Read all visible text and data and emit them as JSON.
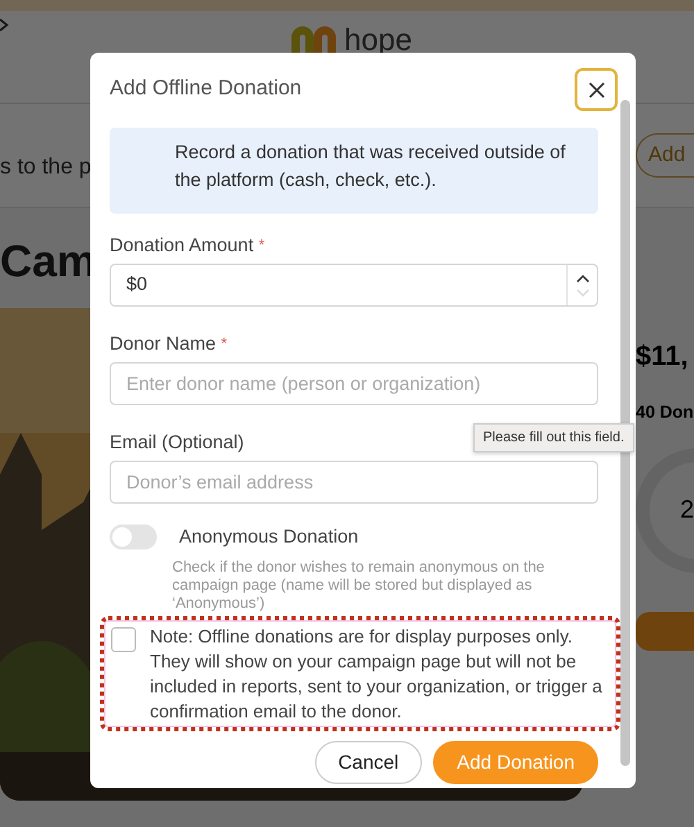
{
  "page": {
    "logo_text": "hope",
    "subtitle_fragment": "s to the p",
    "add_button": "Add",
    "heading_fragment": "Cam",
    "amount_fragment": "$11,",
    "donors_fragment": "40 Don",
    "percent_fragment": "2"
  },
  "modal": {
    "title": "Add Offline Donation",
    "info": "Record a donation that was received outside of the platform (cash, check, etc.).",
    "fields": [
      {
        "label": "Donation Amount",
        "required_mark": "*",
        "kind": "number",
        "value": "$0"
      },
      {
        "label": "Donor Name",
        "required_mark": "*",
        "kind": "text",
        "placeholder": "Enter donor name (person or organization)"
      },
      {
        "label": "Email (Optional)",
        "kind": "text",
        "placeholder": "Donor’s email address"
      }
    ],
    "tooltip": "Please fill out this field.",
    "anonymous": {
      "label": "Anonymous Donation",
      "on": false,
      "help": "Check if the donor wishes to remain anonymous on the campaign page (name will be stored but displayed as ‘Anonymous’)"
    },
    "note": {
      "text": "Note: Offline donations are for display purposes only. They will show on your campaign page but will not be included in reports, sent to your organization, or trigger a confirmation email to the donor.",
      "checked": false,
      "highlighted": true
    },
    "buttons": [
      {
        "label": "Cancel",
        "kind": "secondary"
      },
      {
        "label": "Add Donation",
        "kind": "primary"
      }
    ]
  }
}
